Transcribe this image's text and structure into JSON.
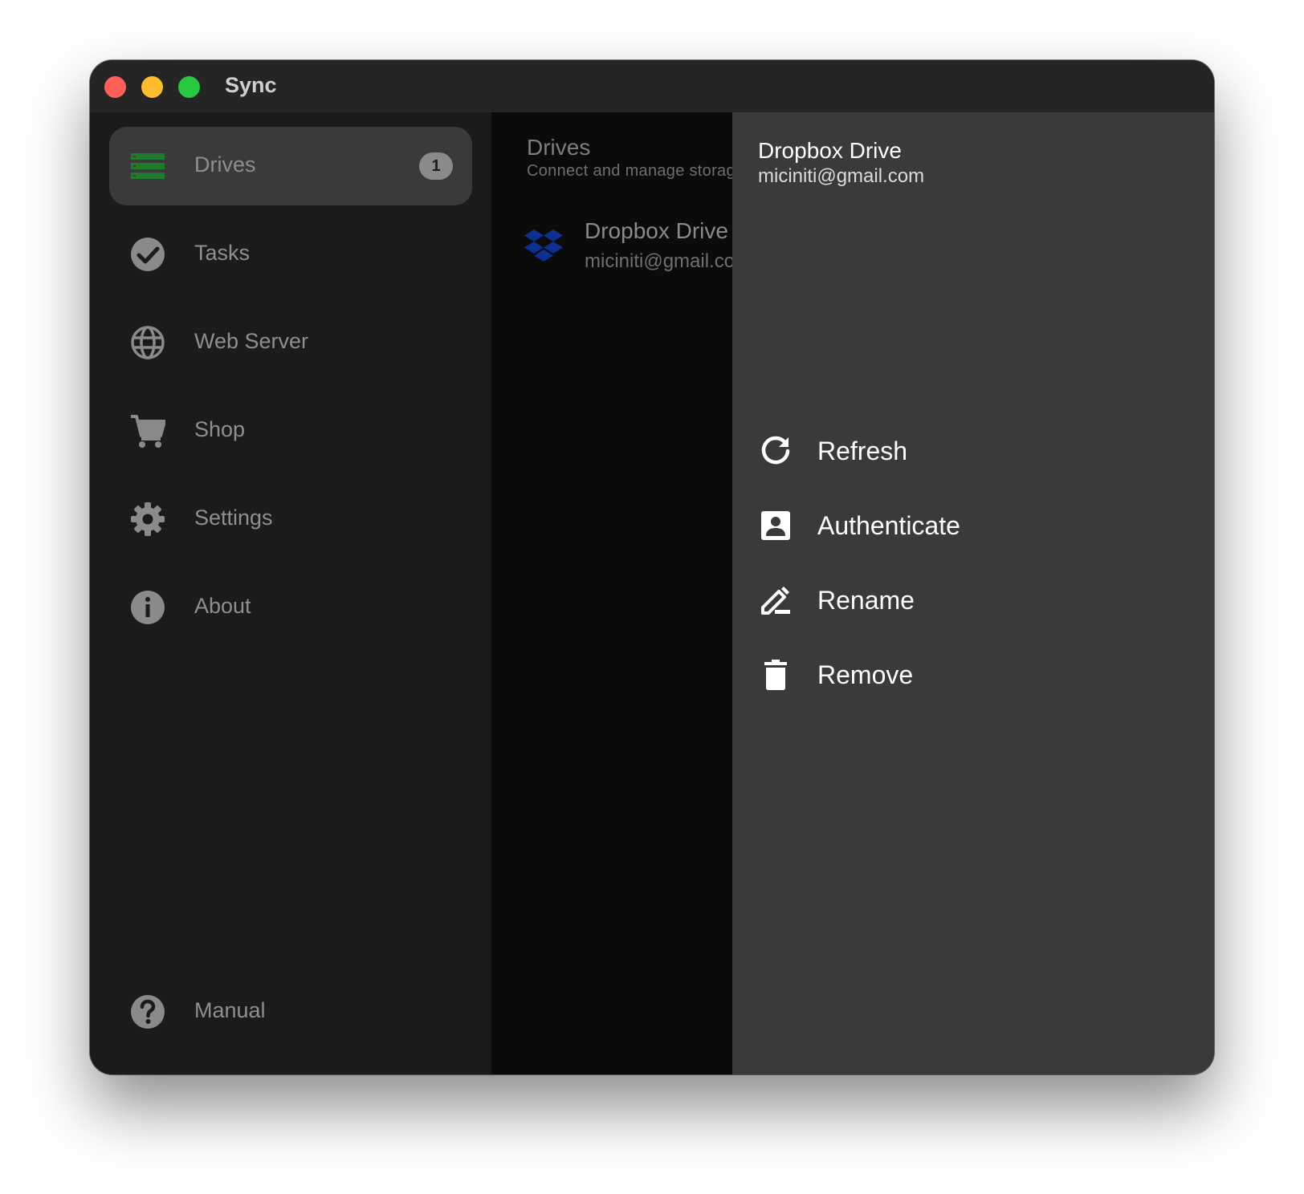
{
  "window": {
    "title": "Sync"
  },
  "sidebar": {
    "items": [
      {
        "label": "Drives",
        "icon": "drives-icon",
        "badge": "1",
        "active": true
      },
      {
        "label": "Tasks",
        "icon": "check-circle-icon"
      },
      {
        "label": "Web Server",
        "icon": "globe-icon"
      },
      {
        "label": "Shop",
        "icon": "cart-icon"
      },
      {
        "label": "Settings",
        "icon": "gear-icon"
      },
      {
        "label": "About",
        "icon": "info-icon"
      }
    ],
    "footer": {
      "label": "Manual",
      "icon": "help-icon"
    }
  },
  "main": {
    "title": "Drives",
    "subtitle": "Connect and manage storage",
    "drives": [
      {
        "name": "Dropbox Drive",
        "email": "miciniti@gmail.com",
        "icon": "dropbox-icon"
      }
    ]
  },
  "panel": {
    "title": "Dropbox Drive",
    "subtitle": "miciniti@gmail.com",
    "actions": [
      {
        "label": "Refresh",
        "icon": "refresh-icon"
      },
      {
        "label": "Authenticate",
        "icon": "account-box-icon"
      },
      {
        "label": "Rename",
        "icon": "rename-icon"
      },
      {
        "label": "Remove",
        "icon": "trash-icon"
      }
    ]
  },
  "colors": {
    "accent": "#1f7a2c",
    "dropbox": "#0d2f8f",
    "sidebar_bg": "#1b1b1b",
    "panel_bg": "#3a3a3a"
  }
}
